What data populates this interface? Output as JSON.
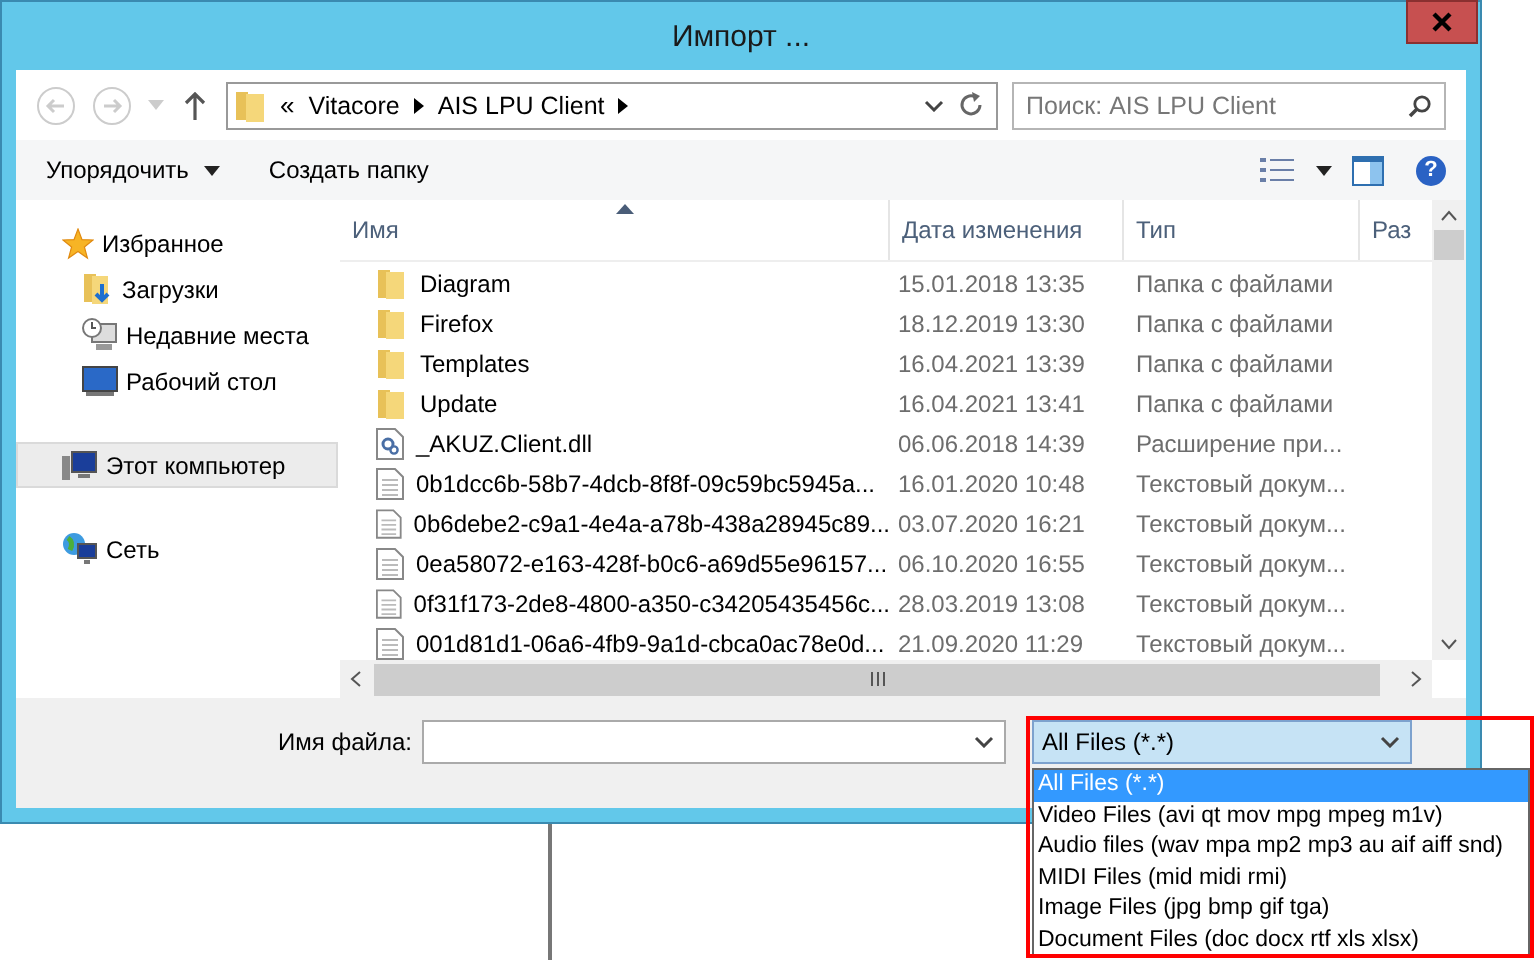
{
  "window": {
    "title": "Импорт ..."
  },
  "address": {
    "overflow": "«",
    "crumbs": [
      "Vitacore",
      "AIS LPU Client"
    ]
  },
  "search": {
    "placeholder": "Поиск: AIS LPU Client"
  },
  "toolbar": {
    "organize": "Упорядочить",
    "new_folder": "Создать папку",
    "help": "?"
  },
  "sidebar": {
    "items": [
      {
        "label": "Избранное",
        "kind": "star",
        "selected": false,
        "children": [
          {
            "label": "Загрузки",
            "kind": "downloads",
            "selected": false
          },
          {
            "label": "Недавние места",
            "kind": "recent",
            "selected": false
          },
          {
            "label": "Рабочий стол",
            "kind": "desktop",
            "selected": false
          }
        ]
      },
      {
        "label": "Этот компьютер",
        "kind": "computer",
        "selected": true
      },
      {
        "label": "Сеть",
        "kind": "network",
        "selected": false
      }
    ]
  },
  "table": {
    "columns": [
      "Имя",
      "Дата изменения",
      "Тип",
      "Раз"
    ],
    "rows": [
      {
        "name": "Diagram",
        "date": "15.01.2018 13:35",
        "type": "Папка с файлами",
        "kind": "folder",
        "selected": false
      },
      {
        "name": "Firefox",
        "date": "18.12.2019 13:30",
        "type": "Папка с файлами",
        "kind": "folder",
        "selected": false
      },
      {
        "name": "Templates",
        "date": "16.04.2021 13:39",
        "type": "Папка с файлами",
        "kind": "folder",
        "selected": false
      },
      {
        "name": "Update",
        "date": "16.04.2021 13:41",
        "type": "Папка с файлами",
        "kind": "folder",
        "selected": false
      },
      {
        "name": "_AKUZ.Client.dll",
        "date": "06.06.2018 14:39",
        "type": "Расширение при...",
        "kind": "dll",
        "selected": false
      },
      {
        "name": "0b1dcc6b-58b7-4dcb-8f8f-09c59bc5945a...",
        "date": "16.01.2020 10:48",
        "type": "Текстовый докум...",
        "kind": "text",
        "selected": false
      },
      {
        "name": "0b6debe2-c9a1-4e4a-a78b-438a28945c89...",
        "date": "03.07.2020 16:21",
        "type": "Текстовый докум...",
        "kind": "text",
        "selected": false
      },
      {
        "name": "0ea58072-e163-428f-b0c6-a69d55e96157...",
        "date": "06.10.2020 16:55",
        "type": "Текстовый докум...",
        "kind": "text",
        "selected": false
      },
      {
        "name": "0f31f173-2de8-4800-a350-c34205435456c...",
        "date": "28.03.2019 13:08",
        "type": "Текстовый докум...",
        "kind": "text",
        "selected": false
      },
      {
        "name": "001d81d1-06a6-4fb9-9a1d-cbca0ac78e0d...",
        "date": "21.09.2020 11:29",
        "type": "Текстовый докум...",
        "kind": "text",
        "selected": false
      }
    ]
  },
  "file_name": {
    "label": "Имя файла:"
  },
  "filter": {
    "value": "All Files (*.*)",
    "options": [
      {
        "label": "All Files (*.*)",
        "selected": true
      },
      {
        "label": "Video Files (avi qt mov mpg mpeg m1v)",
        "selected": false
      },
      {
        "label": "Audio files (wav mpa mp2 mp3 au aif aiff snd)",
        "selected": false
      },
      {
        "label": "MIDI Files (mid midi rmi)",
        "selected": false
      },
      {
        "label": "Image Files (jpg bmp gif tga)",
        "selected": false
      },
      {
        "label": "Document Files (doc docx rtf xls xlsx)",
        "selected": false
      }
    ]
  }
}
